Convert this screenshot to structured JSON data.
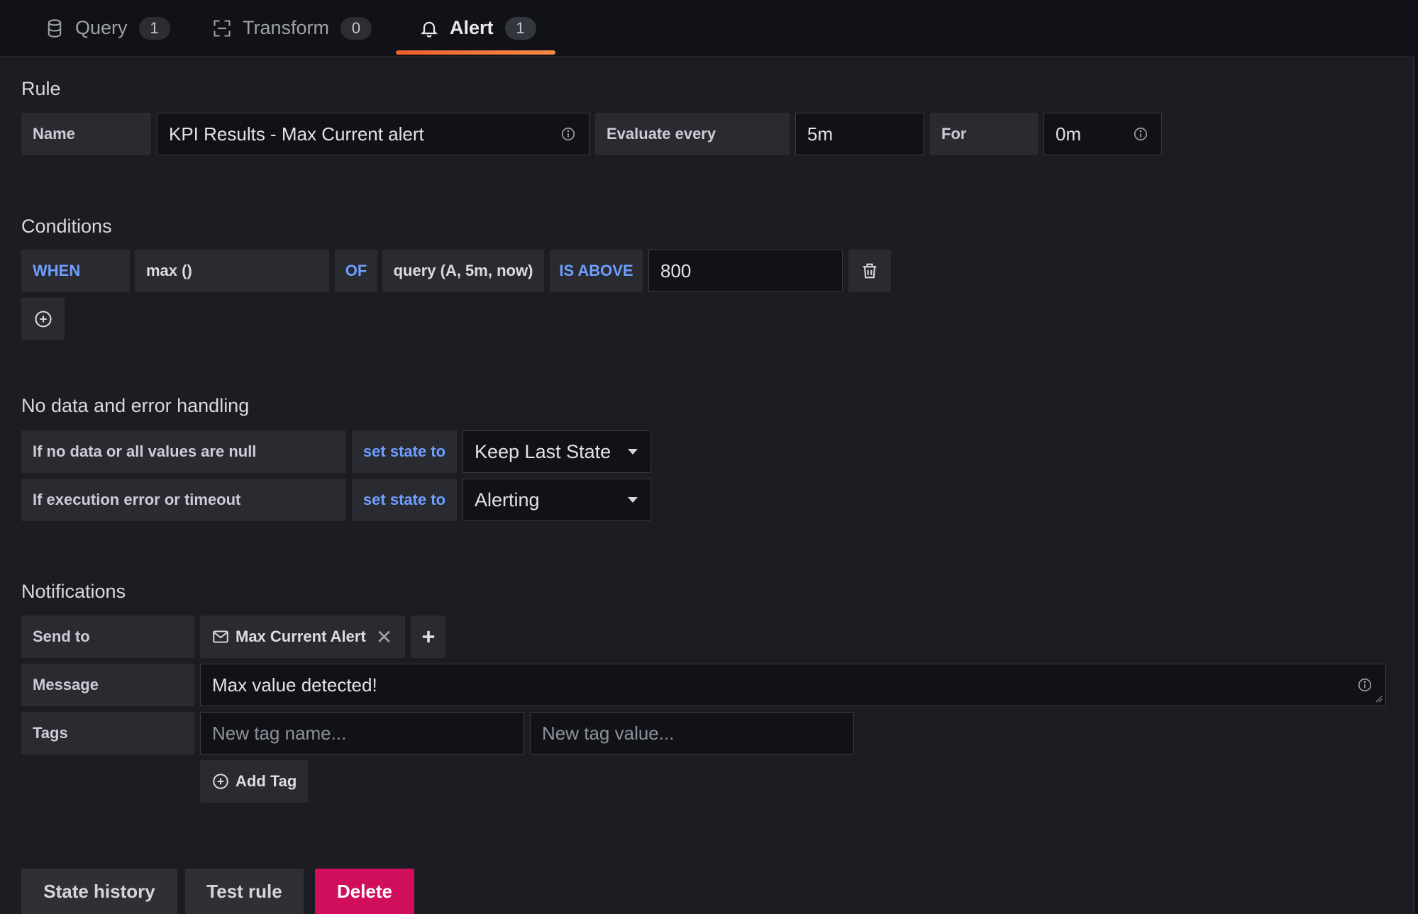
{
  "tabs": [
    {
      "label": "Query",
      "count": "1",
      "icon": "database-icon"
    },
    {
      "label": "Transform",
      "count": "0",
      "icon": "transform-icon"
    },
    {
      "label": "Alert",
      "count": "1",
      "icon": "bell-icon",
      "active": true
    }
  ],
  "accent": "#f05a28",
  "rule": {
    "title": "Rule",
    "name_label": "Name",
    "name_value": "KPI Results - Max Current alert",
    "evaluate_label": "Evaluate every",
    "evaluate_value": "5m",
    "for_label": "For",
    "for_value": "0m"
  },
  "conditions": {
    "title": "Conditions",
    "when": "WHEN",
    "reducer": "max ()",
    "of": "OF",
    "query": "query (A, 5m, now)",
    "evaluator": "IS ABOVE",
    "threshold": "800"
  },
  "nodata": {
    "title": "No data and error handling",
    "no_data_label": "If no data or all values are null",
    "set_state_to": "set state to",
    "no_data_state": "Keep Last State",
    "exec_error_label": "If execution error or timeout",
    "exec_error_state": "Alerting"
  },
  "notifications": {
    "title": "Notifications",
    "send_to_label": "Send to",
    "channel": "Max Current Alert",
    "message_label": "Message",
    "message_value": "Max value detected!",
    "tags_label": "Tags",
    "tag_name_placeholder": "New tag name...",
    "tag_value_placeholder": "New tag value...",
    "add_tag": "Add Tag"
  },
  "actions": {
    "state_history": "State history",
    "test_rule": "Test rule",
    "delete": "Delete",
    "danger_color": "#d10e5c"
  }
}
